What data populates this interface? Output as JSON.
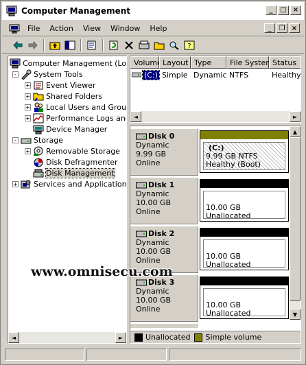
{
  "window": {
    "title": "Computer Management"
  },
  "caption_buttons": {
    "minimize": "_",
    "maximize": "□",
    "close": "×"
  },
  "menu": {
    "items": [
      "File",
      "Action",
      "View",
      "Window",
      "Help"
    ]
  },
  "mdi_buttons": {
    "minimize": "_",
    "restore": "❐",
    "close": "×"
  },
  "toolbar": {
    "icons": [
      "back-arrow-icon",
      "forward-arrow-icon",
      "up-folder-icon",
      "show-hide-tree-icon",
      "properties-icon",
      "refresh-icon",
      "delete-icon",
      "disk-properties-icon",
      "open-folder-icon",
      "search-icon",
      "help-icon"
    ]
  },
  "tree": {
    "root": "Computer Management (Local)",
    "items": [
      {
        "label": "System Tools",
        "level": 1,
        "expander": "-"
      },
      {
        "label": "Event Viewer",
        "level": 2,
        "expander": "+"
      },
      {
        "label": "Shared Folders",
        "level": 2,
        "expander": "+"
      },
      {
        "label": "Local Users and Groups",
        "level": 2,
        "expander": "+"
      },
      {
        "label": "Performance Logs and Alerts",
        "level": 2,
        "expander": "+"
      },
      {
        "label": "Device Manager",
        "level": 2,
        "expander": ""
      },
      {
        "label": "Storage",
        "level": 1,
        "expander": "-"
      },
      {
        "label": "Removable Storage",
        "level": 2,
        "expander": "+"
      },
      {
        "label": "Disk Defragmenter",
        "level": 2,
        "expander": ""
      },
      {
        "label": "Disk Management",
        "level": 2,
        "expander": "",
        "selected": true
      },
      {
        "label": "Services and Applications",
        "level": 1,
        "expander": "+"
      }
    ]
  },
  "volumes": {
    "columns": [
      "Volume",
      "Layout",
      "Type",
      "File System",
      "Status"
    ],
    "rows": [
      {
        "volume": "(C:)",
        "layout": "Simple",
        "type": "Dynamic",
        "fs": "NTFS",
        "status": "Healthy"
      }
    ]
  },
  "disks": [
    {
      "name": "Disk 0",
      "type": "Dynamic",
      "size": "9.99 GB",
      "state": "Online",
      "part_title": "(C:)",
      "part_line1": "9.99 GB NTFS",
      "part_line2": "Healthy (Boot)",
      "bar_color": "#808000"
    },
    {
      "name": "Disk 1",
      "type": "Dynamic",
      "size": "10.00 GB",
      "state": "Online",
      "part_title": "",
      "part_line1": "10.00 GB",
      "part_line2": "Unallocated",
      "bar_color": "#000000"
    },
    {
      "name": "Disk 2",
      "type": "Dynamic",
      "size": "10.00 GB",
      "state": "Online",
      "part_title": "",
      "part_line1": "10.00 GB",
      "part_line2": "Unallocated",
      "bar_color": "#000000"
    },
    {
      "name": "Disk 3",
      "type": "Dynamic",
      "size": "10.00 GB",
      "state": "Online",
      "part_title": "",
      "part_line1": "10.00 GB",
      "part_line2": "Unallocated",
      "bar_color": "#000000"
    }
  ],
  "legend": {
    "unallocated": "Unallocated",
    "simple": "Simple volume",
    "unallocated_color": "#000000",
    "simple_color": "#808000"
  },
  "watermark": "www.omnisecu.com"
}
